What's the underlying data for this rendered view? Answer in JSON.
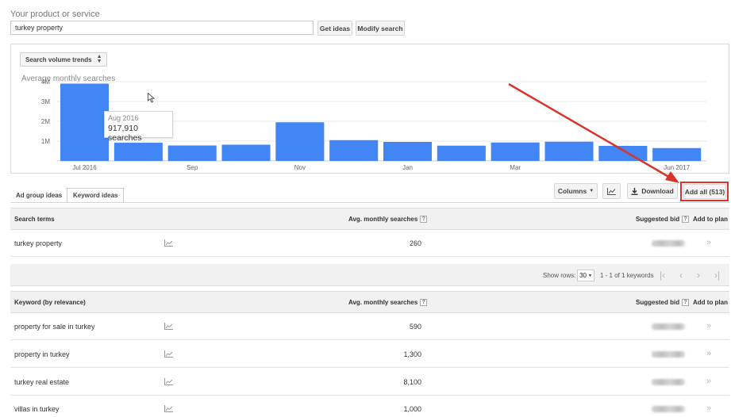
{
  "search": {
    "label": "Your product or service",
    "value": "turkey property",
    "get_ideas": "Get ideas",
    "modify_search": "Modify search"
  },
  "chart_panel": {
    "trend_select": "Search volume trends",
    "tooltip_month": "Aug 2016",
    "tooltip_value": "917,910 searches"
  },
  "chart_data": {
    "type": "bar",
    "title": "Average monthly searches",
    "x_labels": [
      "Jul 2016",
      "Sep",
      "Nov",
      "Jan",
      "Mar",
      "Jun 2017"
    ],
    "x_label_positions": [
      0,
      2,
      4,
      6,
      8,
      11
    ],
    "y_ticks": [
      "1M",
      "2M",
      "3M",
      "4M"
    ],
    "ylim": [
      0,
      4000000
    ],
    "grid": true,
    "color": "#4285f4",
    "values": [
      3900000,
      917910,
      780000,
      820000,
      1950000,
      1050000,
      960000,
      770000,
      930000,
      970000,
      760000,
      650000
    ]
  },
  "tabs": {
    "ad_group": "Ad group ideas",
    "keyword": "Keyword ideas"
  },
  "toolbar": {
    "columns": "Columns",
    "download": "Download",
    "add_all": "Add all (513)"
  },
  "search_terms_table": {
    "col_term": "Search terms",
    "col_volume": "Avg. monthly searches",
    "col_bid": "Suggested bid",
    "col_add": "Add to plan",
    "rows": [
      {
        "keyword": "turkey property",
        "volume": "260"
      }
    ]
  },
  "pager": {
    "show_rows": "Show rows:",
    "rows_value": "30",
    "range": "1 - 1 of 1 keywords"
  },
  "keyword_table": {
    "col_term": "Keyword (by relevance)",
    "col_volume": "Avg. monthly searches",
    "col_bid": "Suggested bid",
    "col_add": "Add to plan",
    "rows": [
      {
        "keyword": "property for sale in turkey",
        "volume": "590"
      },
      {
        "keyword": "property in turkey",
        "volume": "1,300"
      },
      {
        "keyword": "turkey real estate",
        "volume": "8,100"
      },
      {
        "keyword": "villas in turkey",
        "volume": "1,000"
      }
    ]
  },
  "colors": {
    "bar": "#4285f4",
    "annotation": "#d9342b"
  }
}
